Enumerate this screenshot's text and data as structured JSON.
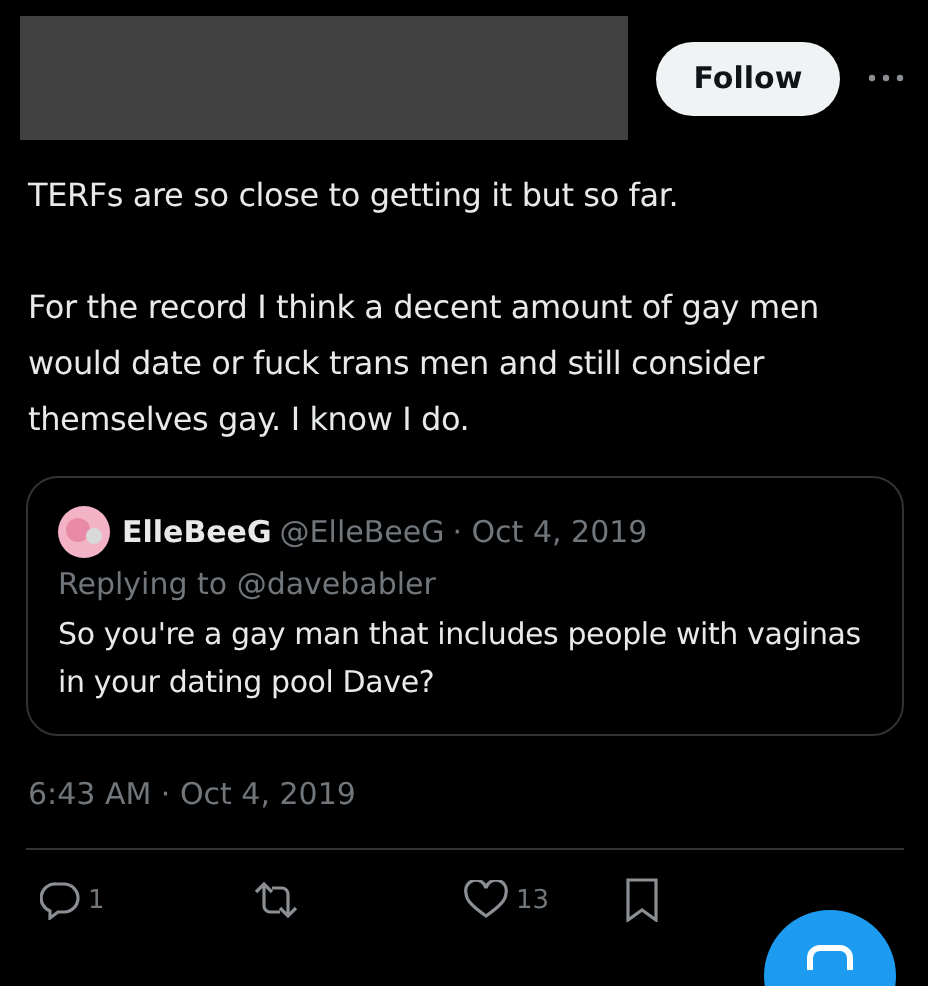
{
  "header": {
    "follow_button": "Follow"
  },
  "tweet": {
    "paragraphs": [
      "TERFs are so close to getting it but so far.",
      "For the record I think a decent amount of gay men would date or fuck trans men and still consider themselves gay. I know I do."
    ]
  },
  "quote": {
    "display_name": "ElleBeeG",
    "handle": "@ElleBeeG",
    "date": "· Oct 4, 2019",
    "replying_to": "Replying to @davebabler",
    "text": "So you're a gay man that includes people with vaginas in your dating pool Dave?"
  },
  "timestamp": "6:43 AM · Oct 4, 2019",
  "actions": [
    {
      "kind": "reply",
      "count": "1"
    },
    {
      "kind": "retweet"
    },
    {
      "kind": "like",
      "count": "13"
    },
    {
      "kind": "bookmark"
    }
  ]
}
